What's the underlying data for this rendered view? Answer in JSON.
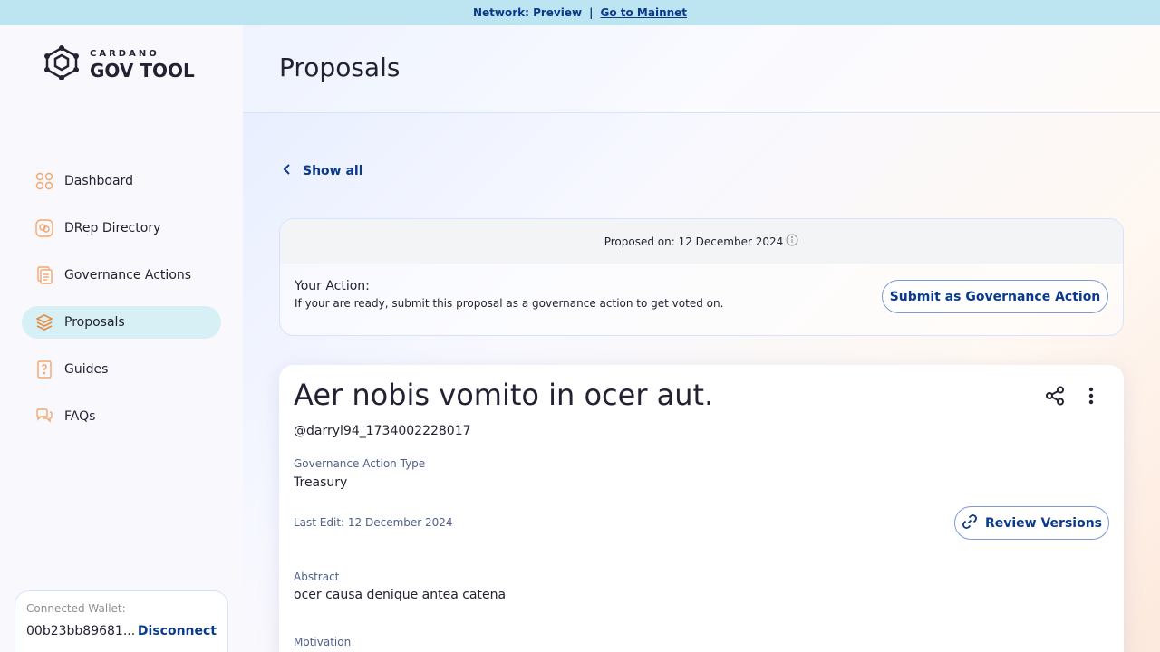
{
  "topbar": {
    "network_label": "Network: Preview",
    "separator": "|",
    "mainnet_link": "Go to Mainnet"
  },
  "logo": {
    "small": "CARDANO",
    "big": "GOV TOOL"
  },
  "sidebar": {
    "items": [
      {
        "label": "Dashboard",
        "icon": "dashboard-icon"
      },
      {
        "label": "DRep Directory",
        "icon": "drep-directory-icon"
      },
      {
        "label": "Governance Actions",
        "icon": "governance-actions-icon"
      },
      {
        "label": "Proposals",
        "icon": "proposals-icon",
        "active": true
      },
      {
        "label": "Guides",
        "icon": "guides-icon"
      },
      {
        "label": "FAQs",
        "icon": "faqs-icon"
      }
    ],
    "wallet": {
      "label": "Connected Wallet:",
      "address": "00b23bb89681...",
      "disconnect": "Disconnect"
    }
  },
  "main": {
    "title": "Proposals",
    "back_label": "Show all",
    "action_card": {
      "proposed_on": "Proposed on: 12 December 2024",
      "your_action_title": "Your Action:",
      "your_action_desc": "If your are ready, submit this proposal as a governance action to get voted on.",
      "submit_button": "Submit as Governance Action"
    },
    "proposal": {
      "title": "Aer nobis vomito in ocer aut.",
      "username": "@darryl94_1734002228017",
      "type_label": "Governance Action Type",
      "type_value": "Treasury",
      "last_edit": "Last Edit: 12 December 2024",
      "review_button": "Review Versions",
      "abstract_label": "Abstract",
      "abstract_value": "ocer causa denique antea catena",
      "motivation_label": "Motivation"
    }
  },
  "colors": {
    "accent": "#0b3a8c",
    "topbar_bg": "#bde4f1",
    "active_nav": "#d6f0f5",
    "icon_orange": "#f5a66b"
  }
}
